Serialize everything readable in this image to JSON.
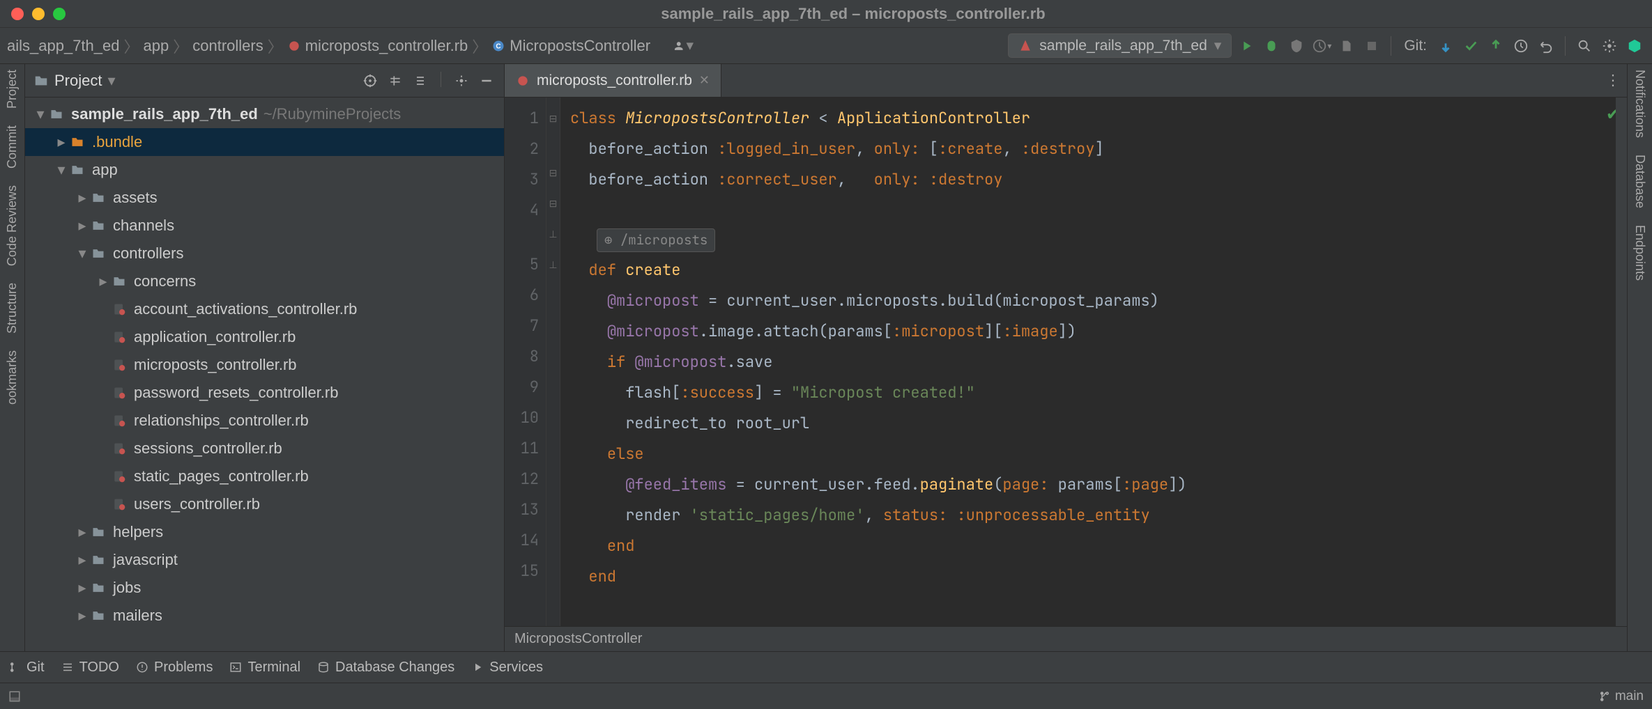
{
  "window": {
    "title": "sample_rails_app_7th_ed – microposts_controller.rb"
  },
  "breadcrumb": {
    "items": [
      "ails_app_7th_ed",
      "app",
      "controllers",
      "microposts_controller.rb",
      "MicropostsController"
    ]
  },
  "run_config": {
    "label": "sample_rails_app_7th_ed"
  },
  "toolbar": {
    "git_label": "Git:"
  },
  "project_panel": {
    "title": "Project",
    "root": {
      "name": "sample_rails_app_7th_ed",
      "path": "~/RubymineProjects"
    },
    "tree": [
      {
        "name": ".bundle",
        "depth": 1,
        "icon": "folder-orange",
        "arrow": "right",
        "selected": true
      },
      {
        "name": "app",
        "depth": 1,
        "icon": "folder",
        "arrow": "down"
      },
      {
        "name": "assets",
        "depth": 2,
        "icon": "folder",
        "arrow": "right"
      },
      {
        "name": "channels",
        "depth": 2,
        "icon": "folder",
        "arrow": "right"
      },
      {
        "name": "controllers",
        "depth": 2,
        "icon": "folder",
        "arrow": "down"
      },
      {
        "name": "concerns",
        "depth": 3,
        "icon": "folder",
        "arrow": "right"
      },
      {
        "name": "account_activations_controller.rb",
        "depth": 3,
        "icon": "ruby"
      },
      {
        "name": "application_controller.rb",
        "depth": 3,
        "icon": "ruby"
      },
      {
        "name": "microposts_controller.rb",
        "depth": 3,
        "icon": "ruby"
      },
      {
        "name": "password_resets_controller.rb",
        "depth": 3,
        "icon": "ruby"
      },
      {
        "name": "relationships_controller.rb",
        "depth": 3,
        "icon": "ruby"
      },
      {
        "name": "sessions_controller.rb",
        "depth": 3,
        "icon": "ruby"
      },
      {
        "name": "static_pages_controller.rb",
        "depth": 3,
        "icon": "ruby"
      },
      {
        "name": "users_controller.rb",
        "depth": 3,
        "icon": "ruby"
      },
      {
        "name": "helpers",
        "depth": 2,
        "icon": "folder",
        "arrow": "right"
      },
      {
        "name": "javascript",
        "depth": 2,
        "icon": "folder",
        "arrow": "right"
      },
      {
        "name": "jobs",
        "depth": 2,
        "icon": "folder",
        "arrow": "right"
      },
      {
        "name": "mailers",
        "depth": 2,
        "icon": "folder",
        "arrow": "right"
      }
    ]
  },
  "left_rail": [
    "Project",
    "Commit",
    "Code Reviews",
    "Structure",
    "ookmarks"
  ],
  "right_rail": [
    "Notifications",
    "Database",
    "Endpoints"
  ],
  "editor": {
    "tab": "microposts_controller.rb",
    "route_hint": "/microposts",
    "breadcrumb": "MicropostsController",
    "lines": [
      {
        "n": 1,
        "html": "<span class='kw'>class</span> <span class='cls'>MicropostsController</span> < <span class='fn'>ApplicationController</span>"
      },
      {
        "n": 2,
        "html": "  before_action <span class='sym'>:logged_in_user</span>, <span class='sym'>only:</span> [<span class='sym'>:create</span>, <span class='sym'>:destroy</span>]"
      },
      {
        "n": 3,
        "html": "  before_action <span class='sym'>:correct_user</span>,   <span class='sym'>only:</span> <span class='sym'>:destroy</span>"
      },
      {
        "n": 4,
        "html": ""
      },
      {
        "n": 5,
        "html": "  <span class='kw'>def</span> <span class='fn'>create</span>",
        "route_before": true
      },
      {
        "n": 6,
        "html": "    <span class='ivar'>@micropost</span> = current_user.microposts.build(micropost_params)"
      },
      {
        "n": 7,
        "html": "    <span class='ivar'>@micropost</span>.image.attach(params[<span class='sym'>:micropost</span>][<span class='sym'>:image</span>])"
      },
      {
        "n": 8,
        "html": "    <span class='kw'>if</span> <span class='ivar'>@micropost</span>.save"
      },
      {
        "n": 9,
        "html": "      flash[<span class='sym'>:success</span>] = <span class='str'>\"Micropost created!\"</span>"
      },
      {
        "n": 10,
        "html": "      redirect_to root_url"
      },
      {
        "n": 11,
        "html": "    <span class='kw'>else</span>"
      },
      {
        "n": 12,
        "html": "      <span class='ivar'>@feed_items</span> = current_user.feed.<span class='call'>paginate</span>(<span class='sym'>page:</span> params[<span class='sym'>:page</span>])"
      },
      {
        "n": 13,
        "html": "      render <span class='str'>'static_pages/home'</span>, <span class='sym'>status:</span> <span class='sym'>:unprocessable_entity</span>"
      },
      {
        "n": 14,
        "html": "    <span class='kw'>end</span>"
      },
      {
        "n": 15,
        "html": "  <span class='kw'>end</span>"
      }
    ]
  },
  "bottom_bar": [
    "Git",
    "TODO",
    "Problems",
    "Terminal",
    "Database Changes",
    "Services"
  ],
  "status_bar": {
    "branch": "main"
  }
}
